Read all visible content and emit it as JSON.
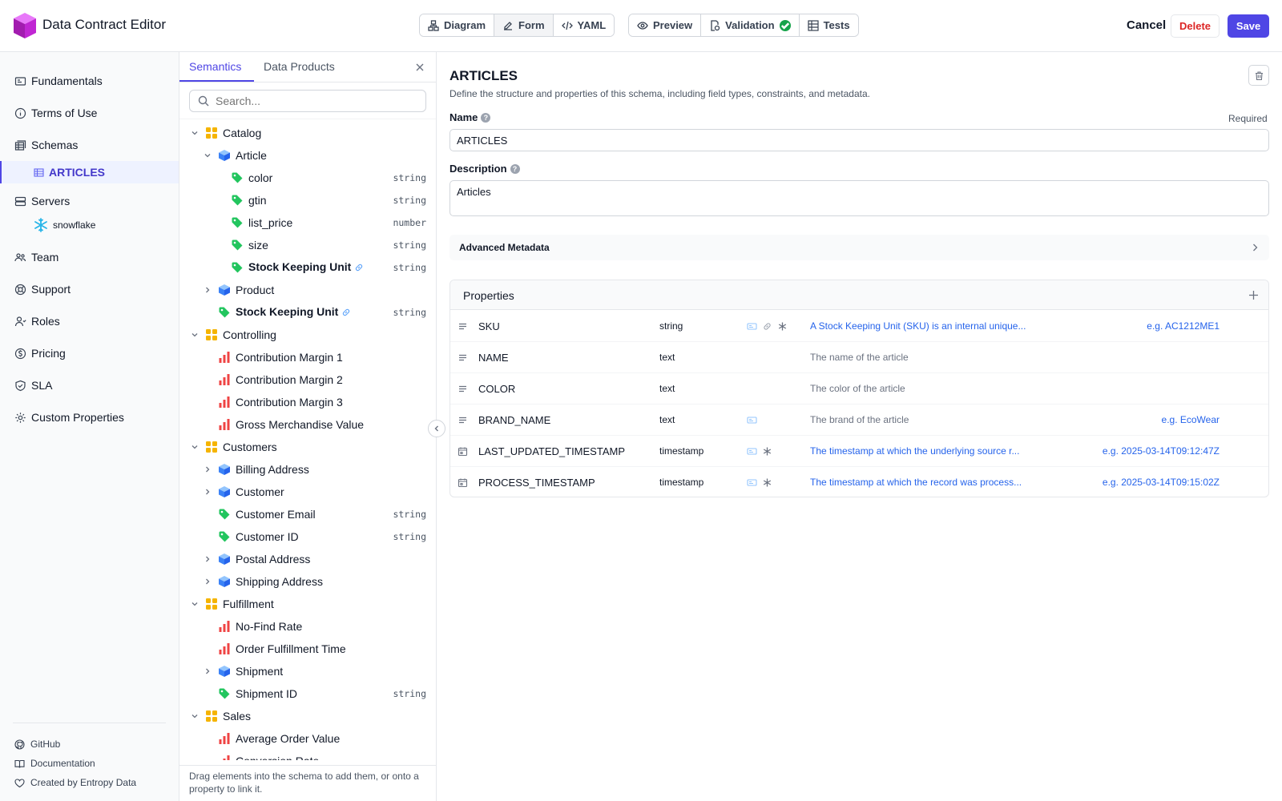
{
  "app": {
    "title": "Data Contract Editor"
  },
  "toolbar": {
    "view_group": [
      {
        "label": "Diagram",
        "icon": "diagram-icon"
      },
      {
        "label": "Form",
        "icon": "form-icon"
      },
      {
        "label": "YAML",
        "icon": "code-icon"
      }
    ],
    "tools_group": [
      {
        "label": "Preview",
        "icon": "eye-icon"
      },
      {
        "label": "Validation",
        "icon": "validation-icon"
      },
      {
        "label": "Tests",
        "icon": "tests-icon"
      }
    ],
    "cancel": "Cancel",
    "delete": "Delete",
    "save": "Save"
  },
  "nav": {
    "fundamentals": "Fundamentals",
    "terms": "Terms of Use",
    "schemas": "Schemas",
    "schema_articles": "ARTICLES",
    "servers": "Servers",
    "server_snowflake": "snowflake",
    "team": "Team",
    "support": "Support",
    "roles": "Roles",
    "pricing": "Pricing",
    "sla": "SLA",
    "custom": "Custom Properties",
    "github": "GitHub",
    "documentation": "Documentation",
    "created_by": "Created by Entropy Data"
  },
  "semantics": {
    "tabs": [
      "Semantics",
      "Data Products"
    ],
    "search_placeholder": "Search...",
    "tree": [
      {
        "label": "Catalog",
        "kind": "domain",
        "level": 0,
        "chev": "down"
      },
      {
        "label": "Article",
        "kind": "entity",
        "level": 1,
        "chev": "down"
      },
      {
        "label": "color",
        "kind": "attribute",
        "level": 2,
        "type": "string"
      },
      {
        "label": "gtin",
        "kind": "attribute",
        "level": 2,
        "type": "string"
      },
      {
        "label": "list_price",
        "kind": "attribute",
        "level": 2,
        "type": "number"
      },
      {
        "label": "size",
        "kind": "attribute",
        "level": 2,
        "type": "string"
      },
      {
        "label": "Stock Keeping Unit",
        "kind": "attribute",
        "level": 2,
        "type": "string",
        "bold": true,
        "linked": true
      },
      {
        "label": "Product",
        "kind": "entity",
        "level": 1,
        "chev": "right"
      },
      {
        "label": "Stock Keeping Unit",
        "kind": "attribute",
        "level": 1,
        "type": "string",
        "bold": true,
        "linked": true
      },
      {
        "label": "Controlling",
        "kind": "domain",
        "level": 0,
        "chev": "down"
      },
      {
        "label": "Contribution Margin 1",
        "kind": "metric",
        "level": 1
      },
      {
        "label": "Contribution Margin 2",
        "kind": "metric",
        "level": 1
      },
      {
        "label": "Contribution Margin 3",
        "kind": "metric",
        "level": 1
      },
      {
        "label": "Gross Merchandise Value",
        "kind": "metric",
        "level": 1
      },
      {
        "label": "Customers",
        "kind": "domain",
        "level": 0,
        "chev": "down"
      },
      {
        "label": "Billing Address",
        "kind": "entity",
        "level": 1,
        "chev": "right"
      },
      {
        "label": "Customer",
        "kind": "entity",
        "level": 1,
        "chev": "right"
      },
      {
        "label": "Customer Email",
        "kind": "attribute",
        "level": 1,
        "type": "string"
      },
      {
        "label": "Customer ID",
        "kind": "attribute",
        "level": 1,
        "type": "string"
      },
      {
        "label": "Postal Address",
        "kind": "entity",
        "level": 1,
        "chev": "right"
      },
      {
        "label": "Shipping Address",
        "kind": "entity",
        "level": 1,
        "chev": "right"
      },
      {
        "label": "Fulfillment",
        "kind": "domain",
        "level": 0,
        "chev": "down"
      },
      {
        "label": "No-Find Rate",
        "kind": "metric",
        "level": 1
      },
      {
        "label": "Order Fulfillment Time",
        "kind": "metric",
        "level": 1
      },
      {
        "label": "Shipment",
        "kind": "entity",
        "level": 1,
        "chev": "right"
      },
      {
        "label": "Shipment ID",
        "kind": "attribute",
        "level": 1,
        "type": "string"
      },
      {
        "label": "Sales",
        "kind": "domain",
        "level": 0,
        "chev": "down"
      },
      {
        "label": "Average Order Value",
        "kind": "metric",
        "level": 1
      },
      {
        "label": "Conversion Rate",
        "kind": "metric",
        "level": 1
      }
    ],
    "hint": "Drag elements into the schema to add them, or onto a property to link it."
  },
  "schema": {
    "title": "ARTICLES",
    "description": "Define the structure and properties of this schema, including field types, constraints, and metadata.",
    "name_label": "Name",
    "required": "Required",
    "name_value": "ARTICLES",
    "description_label": "Description",
    "description_value": "Articles",
    "advanced": "Advanced Metadata",
    "properties_title": "Properties",
    "properties": [
      {
        "name": "SKU",
        "type": "string",
        "icon": "text-lines-icon",
        "flags": [
          "id-card-icon",
          "link-icon",
          "asterisk-icon"
        ],
        "description": "A Stock Keeping Unit (SKU) is an internal unique...",
        "desc_style": "link",
        "example": "e.g. AC1212ME1"
      },
      {
        "name": "NAME",
        "type": "text",
        "icon": "text-lines-icon",
        "flags": [],
        "description": "The name of the article",
        "desc_style": "muted",
        "example": ""
      },
      {
        "name": "COLOR",
        "type": "text",
        "icon": "text-lines-icon",
        "flags": [],
        "description": "The color of the article",
        "desc_style": "muted",
        "example": ""
      },
      {
        "name": "BRAND_NAME",
        "type": "text",
        "icon": "text-lines-icon",
        "flags": [
          "id-card-icon"
        ],
        "description": "The brand of the article",
        "desc_style": "muted",
        "example": "e.g. EcoWear"
      },
      {
        "name": "LAST_UPDATED_TIMESTAMP",
        "type": "timestamp",
        "icon": "calendar-icon",
        "flags": [
          "id-card-icon",
          "asterisk-icon"
        ],
        "description": "The timestamp at which the underlying source r...",
        "desc_style": "link",
        "example": "e.g. 2025-03-14T09:12:47Z"
      },
      {
        "name": "PROCESS_TIMESTAMP",
        "type": "timestamp",
        "icon": "calendar-icon",
        "flags": [
          "id-card-icon",
          "asterisk-icon"
        ],
        "description": "The timestamp at which the record was process...",
        "desc_style": "link",
        "example": "e.g. 2025-03-14T09:15:02Z"
      }
    ]
  },
  "colors": {
    "accent": "#4f46e5",
    "danger": "#dc2626",
    "domain": "#f5b400",
    "entity": "#3b82f6",
    "attribute": "#22c55e",
    "metric": "#ef4444",
    "link": "#2563eb"
  }
}
